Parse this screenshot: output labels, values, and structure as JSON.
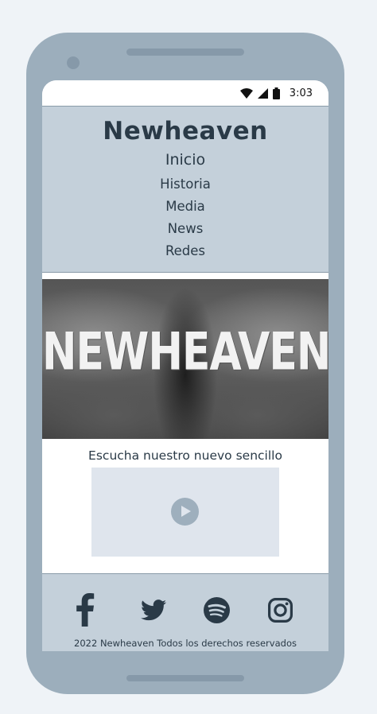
{
  "status_bar": {
    "time": "3:03"
  },
  "site": {
    "title": "Newheaven",
    "nav": [
      "Inicio",
      "Historia",
      "Media",
      "News",
      "Redes"
    ]
  },
  "banner": {
    "logo_text": "NEWHEAVEN"
  },
  "single": {
    "heading": "Escucha nuestro nuevo sencillo"
  },
  "footer": {
    "social_icons": [
      "facebook-icon",
      "twitter-icon",
      "spotify-icon",
      "instagram-icon"
    ],
    "copyright": "2022 Newheaven Todos los derechos reservados"
  },
  "colors": {
    "page_bg": "#eff3f7",
    "phone_frame": "#9caebc",
    "header_bg": "#c4d0da",
    "text_dark": "#2a3a47",
    "player_bg": "#dfe5ed",
    "play_button": "#9eafbd"
  }
}
